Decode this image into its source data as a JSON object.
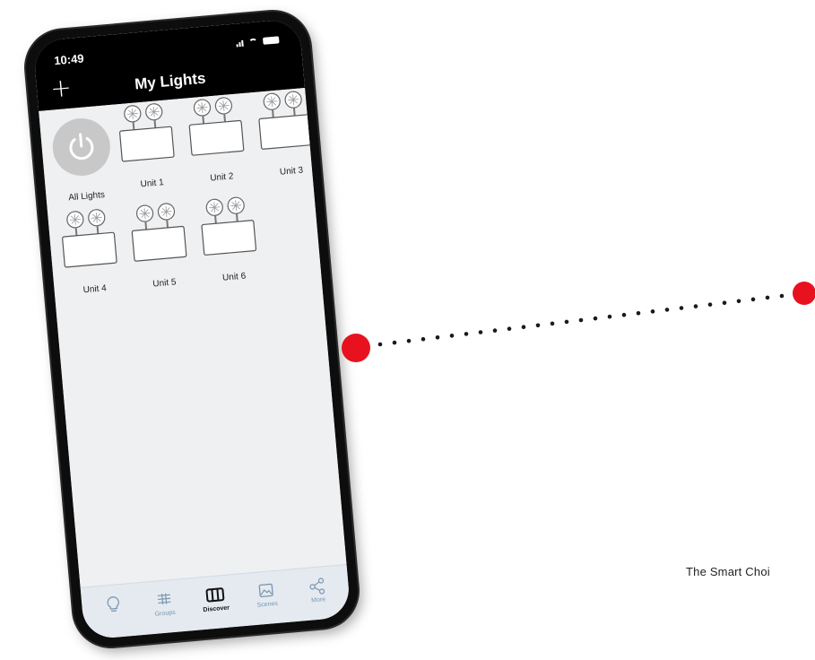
{
  "status_bar": {
    "time": "10:49"
  },
  "header": {
    "title": "My Lights",
    "add_label": "+"
  },
  "tiles": [
    {
      "label": "All Lights",
      "kind": "power"
    },
    {
      "label": "Unit 1",
      "kind": "unit"
    },
    {
      "label": "Unit 2",
      "kind": "unit"
    },
    {
      "label": "Unit 3",
      "kind": "unit"
    },
    {
      "label": "Unit 4",
      "kind": "unit"
    },
    {
      "label": "Unit 5",
      "kind": "unit"
    },
    {
      "label": "Unit 6",
      "kind": "unit"
    }
  ],
  "tabbar": {
    "items": [
      {
        "label": "",
        "icon": "lightbulb-icon",
        "active": false
      },
      {
        "label": "Groups",
        "icon": "groups-icon",
        "active": false
      },
      {
        "label": "Discover",
        "icon": "discover-icon",
        "active": true
      },
      {
        "label": "Scenes",
        "icon": "scenes-icon",
        "active": false
      },
      {
        "label": "More",
        "icon": "share-icon",
        "active": false
      }
    ]
  },
  "caption": "The Smart Choi",
  "colors": {
    "accent_red": "#e8121f",
    "tab_inactive": "#7a95b0",
    "header_bg": "#000000",
    "screen_bg": "#eef0f2",
    "power_gray": "#c8c8c8"
  }
}
